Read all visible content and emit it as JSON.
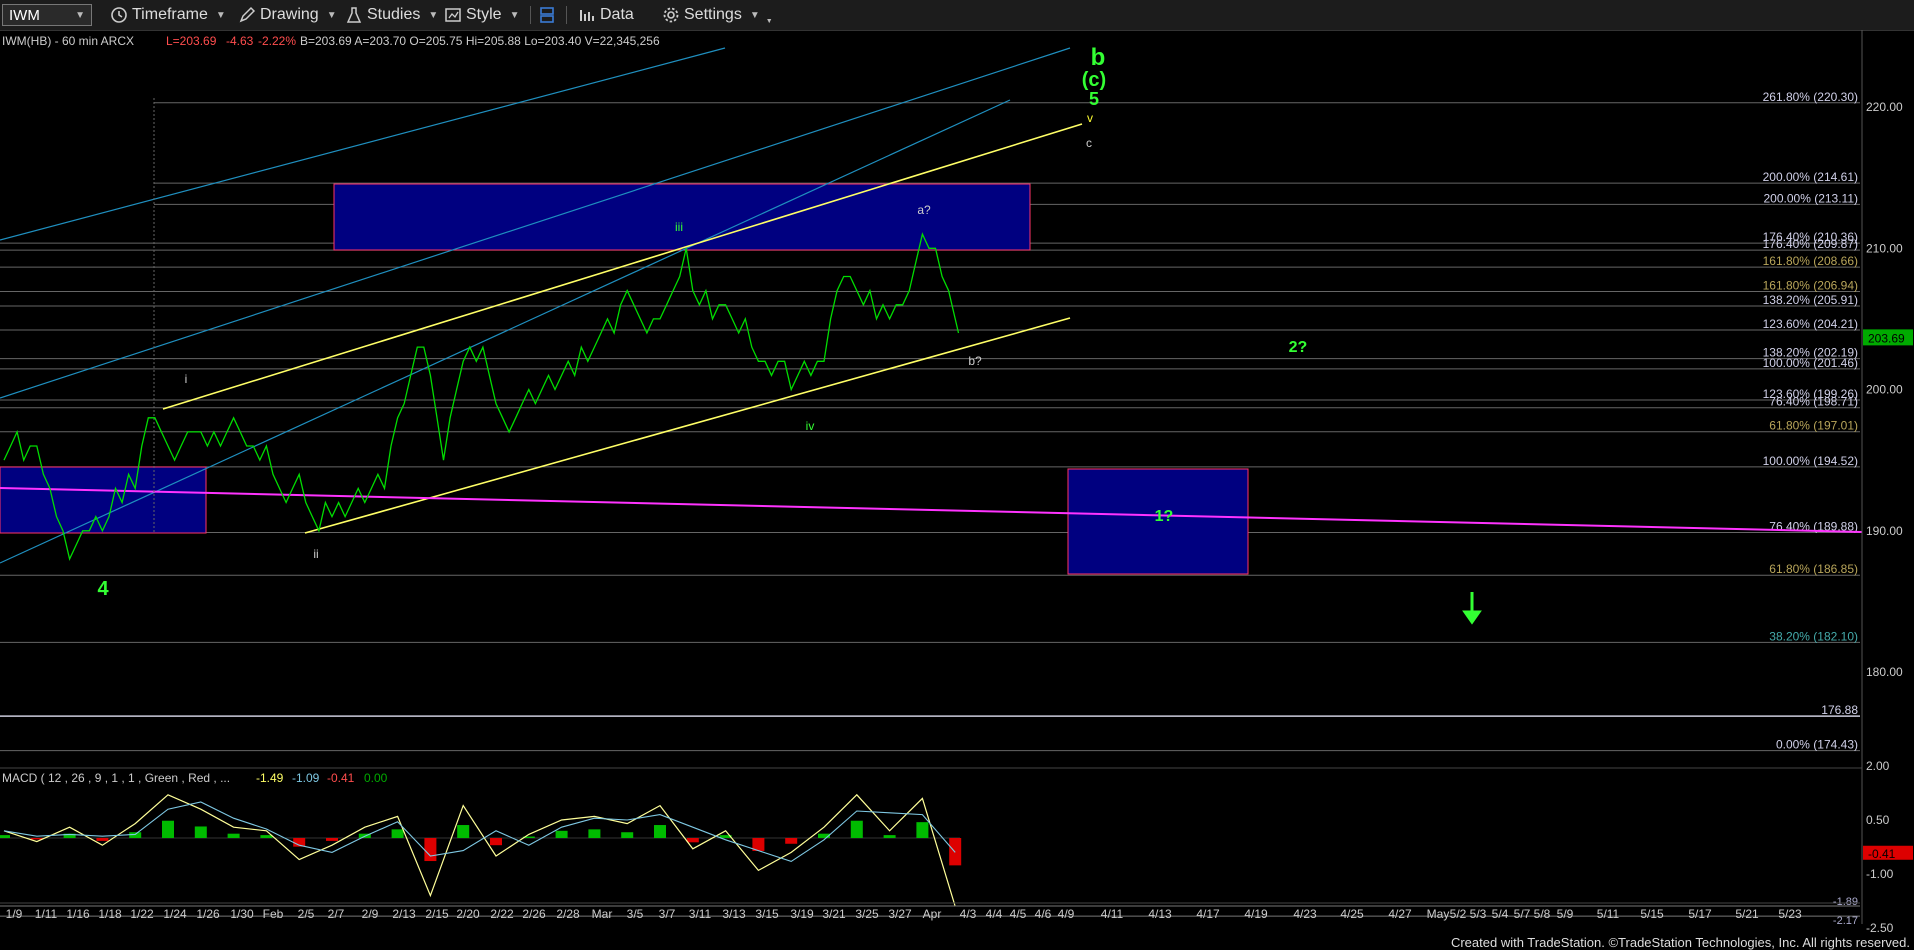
{
  "toolbar": {
    "symbol": "IWM",
    "timeframe": "Timeframe",
    "drawing": "Drawing",
    "studies": "Studies",
    "style": "Style",
    "data": "Data",
    "settings": "Settings"
  },
  "header": {
    "symbol_desc": "IWM(HB) - 60 min  ARCX",
    "last": "L=203.69",
    "chg": "-4.63",
    "pct": "-2.22%",
    "ohlc": "B=203.69  A=203.70  O=205.75  Hi=205.88  Lo=203.40  V=22,345,256"
  },
  "macd_header": {
    "label": "MACD ( 12 , 26 , 9 , 1 , 1 , Green , Red , ...",
    "v1": "-1.49",
    "v2": "-1.09",
    "v3": "-0.41",
    "v4": "0.00"
  },
  "footer": "Created with TradeStation. ©TradeStation Technologies, Inc. All rights reserved.",
  "colors": {
    "price": "#00dd00",
    "channel": "#ffff66",
    "magenta": "#ff33ff",
    "box": "#000080",
    "label_green": "#33ff33"
  },
  "chart_data": {
    "type": "line",
    "price_axis": {
      "ticks": [
        "220.00",
        "210.00",
        "200.00",
        "190.00",
        "180.00"
      ],
      "current": "203.69"
    },
    "macd_axis": {
      "ticks": [
        "2.00",
        "0.50",
        "-1.00",
        "-2.50"
      ],
      "badges": [
        "-0.41",
        "-1.89",
        "-2.17"
      ]
    },
    "x_labels": [
      "1/9",
      "1/11",
      "1/16",
      "1/18",
      "1/22",
      "1/24",
      "1/26",
      "1/30",
      "Feb",
      "2/5",
      "2/7",
      "2/9",
      "2/13",
      "2/15",
      "2/20",
      "2/22",
      "2/26",
      "2/28",
      "Mar",
      "3/5",
      "3/7",
      "3/11",
      "3/13",
      "3/15",
      "3/19",
      "3/21",
      "3/25",
      "3/27",
      "Apr",
      "4/3",
      "4/4",
      "4/5",
      "4/6",
      "4/9",
      "4/11",
      "4/13",
      "4/17",
      "4/19",
      "4/23",
      "4/25",
      "4/27",
      "May",
      "5/2",
      "5/3",
      "5/4",
      "5/7",
      "5/8",
      "5/9",
      "5/11",
      "5/15",
      "5/17",
      "5/21",
      "5/23"
    ],
    "fib_levels": [
      {
        "label": "261.80% (220.30)",
        "value": 220.3
      },
      {
        "label": "200.00% (214.61)",
        "value": 214.61
      },
      {
        "label": "200.00% (213.11)",
        "value": 213.11
      },
      {
        "label": "176.40% (210.36)",
        "value": 210.36
      },
      {
        "label": "176.40% (209.87)",
        "value": 209.87
      },
      {
        "label": "161.80% (208.66)",
        "value": 208.66
      },
      {
        "label": "161.80% (206.94)",
        "value": 206.94
      },
      {
        "label": "138.20% (205.91)",
        "value": 205.91
      },
      {
        "label": "123.60% (204.21)",
        "value": 204.21
      },
      {
        "label": "138.20% (202.19)",
        "value": 202.19
      },
      {
        "label": "100.00% (201.46)",
        "value": 201.46
      },
      {
        "label": "123.60% (199.26)",
        "value": 199.26
      },
      {
        "label": "76.40% (198.71)",
        "value": 198.71
      },
      {
        "label": "61.80% (197.01)",
        "value": 197.01
      },
      {
        "label": "100.00% (194.52)",
        "value": 194.52
      },
      {
        "label": "76.40% (189.88)",
        "value": 189.88
      },
      {
        "label": "61.80% (186.85)",
        "value": 186.85
      },
      {
        "label": "38.20% (182.10)",
        "value": 182.1
      },
      {
        "label": "176.88",
        "value": 176.88
      },
      {
        "label": "0.00% (174.43)",
        "value": 174.43
      }
    ],
    "wave_labels": {
      "b": "b",
      "c": "(c)",
      "five": "5",
      "v": "v",
      "cc": "c",
      "iii": "iii",
      "a": "a?",
      "i": "i",
      "bq": "b?",
      "iv": "iv",
      "ii": "ii",
      "four": "4",
      "one": "1?",
      "two": "2?"
    },
    "price_path": [
      [
        0,
        195
      ],
      [
        0.2,
        196
      ],
      [
        0.4,
        197
      ],
      [
        0.6,
        195
      ],
      [
        0.8,
        196
      ],
      [
        1.0,
        196
      ],
      [
        1.2,
        194
      ],
      [
        1.4,
        193
      ],
      [
        1.6,
        191
      ],
      [
        1.8,
        190
      ],
      [
        2.0,
        188
      ],
      [
        2.2,
        189
      ],
      [
        2.4,
        190
      ],
      [
        2.6,
        190
      ],
      [
        2.8,
        191
      ],
      [
        3.0,
        190
      ],
      [
        3.2,
        191
      ],
      [
        3.4,
        193
      ],
      [
        3.6,
        192
      ],
      [
        3.8,
        194
      ],
      [
        4.0,
        193
      ],
      [
        4.2,
        196
      ],
      [
        4.4,
        198
      ],
      [
        4.6,
        198
      ],
      [
        4.8,
        197
      ],
      [
        5.0,
        196
      ],
      [
        5.2,
        195
      ],
      [
        5.4,
        196
      ],
      [
        5.6,
        197
      ],
      [
        5.8,
        197
      ],
      [
        6.0,
        197
      ],
      [
        6.2,
        196
      ],
      [
        6.4,
        197
      ],
      [
        6.6,
        196
      ],
      [
        6.8,
        197
      ],
      [
        7.0,
        198
      ],
      [
        7.2,
        197
      ],
      [
        7.4,
        196
      ],
      [
        7.6,
        196
      ],
      [
        7.8,
        195
      ],
      [
        8.0,
        196
      ],
      [
        8.2,
        194
      ],
      [
        8.4,
        193
      ],
      [
        8.6,
        192
      ],
      [
        8.8,
        193
      ],
      [
        9.0,
        194
      ],
      [
        9.2,
        192
      ],
      [
        9.4,
        191
      ],
      [
        9.6,
        190
      ],
      [
        9.8,
        192
      ],
      [
        10.0,
        191
      ],
      [
        10.2,
        192
      ],
      [
        10.4,
        191
      ],
      [
        10.6,
        192
      ],
      [
        10.8,
        193
      ],
      [
        11.0,
        192
      ],
      [
        11.2,
        193
      ],
      [
        11.4,
        194
      ],
      [
        11.6,
        193
      ],
      [
        11.8,
        196
      ],
      [
        12.0,
        198
      ],
      [
        12.2,
        199
      ],
      [
        12.4,
        201
      ],
      [
        12.6,
        203
      ],
      [
        12.8,
        203
      ],
      [
        13.0,
        201
      ],
      [
        13.2,
        198
      ],
      [
        13.4,
        195
      ],
      [
        13.6,
        198
      ],
      [
        13.8,
        200
      ],
      [
        14.0,
        202
      ],
      [
        14.2,
        203
      ],
      [
        14.4,
        202
      ],
      [
        14.6,
        203
      ],
      [
        14.8,
        201
      ],
      [
        15.0,
        199
      ],
      [
        15.2,
        198
      ],
      [
        15.4,
        197
      ],
      [
        15.6,
        198
      ],
      [
        15.8,
        199
      ],
      [
        16.0,
        200
      ],
      [
        16.2,
        199
      ],
      [
        16.4,
        200
      ],
      [
        16.6,
        201
      ],
      [
        16.8,
        200
      ],
      [
        17.0,
        201
      ],
      [
        17.2,
        202
      ],
      [
        17.4,
        201
      ],
      [
        17.6,
        203
      ],
      [
        17.8,
        202
      ],
      [
        18.0,
        203
      ],
      [
        18.2,
        204
      ],
      [
        18.4,
        205
      ],
      [
        18.6,
        204
      ],
      [
        18.8,
        206
      ],
      [
        19.0,
        207
      ],
      [
        19.2,
        206
      ],
      [
        19.4,
        205
      ],
      [
        19.6,
        204
      ],
      [
        19.8,
        205
      ],
      [
        20.0,
        205
      ],
      [
        20.2,
        206
      ],
      [
        20.4,
        207
      ],
      [
        20.6,
        208
      ],
      [
        20.8,
        210
      ],
      [
        21.0,
        207
      ],
      [
        21.2,
        206
      ],
      [
        21.4,
        207
      ],
      [
        21.6,
        205
      ],
      [
        21.8,
        206
      ],
      [
        22.0,
        206
      ],
      [
        22.2,
        205
      ],
      [
        22.4,
        204
      ],
      [
        22.6,
        205
      ],
      [
        22.8,
        203
      ],
      [
        23.0,
        202
      ],
      [
        23.2,
        202
      ],
      [
        23.4,
        201
      ],
      [
        23.6,
        202
      ],
      [
        23.8,
        202
      ],
      [
        24.0,
        200
      ],
      [
        24.2,
        201
      ],
      [
        24.4,
        202
      ],
      [
        24.6,
        201
      ],
      [
        24.8,
        202
      ],
      [
        25.0,
        202
      ],
      [
        25.2,
        205
      ],
      [
        25.4,
        207
      ],
      [
        25.6,
        208
      ],
      [
        25.8,
        208
      ],
      [
        26.0,
        207
      ],
      [
        26.2,
        206
      ],
      [
        26.4,
        207
      ],
      [
        26.6,
        205
      ],
      [
        26.8,
        206
      ],
      [
        27.0,
        205
      ],
      [
        27.2,
        206
      ],
      [
        27.4,
        206
      ],
      [
        27.6,
        207
      ],
      [
        27.8,
        209
      ],
      [
        28.0,
        211
      ],
      [
        28.2,
        210
      ],
      [
        28.4,
        210
      ],
      [
        28.6,
        208
      ],
      [
        28.8,
        207
      ],
      [
        29.0,
        205
      ],
      [
        29.1,
        204
      ]
    ],
    "macd_path": [
      [
        0,
        0.2
      ],
      [
        1,
        -0.1
      ],
      [
        2,
        0.3
      ],
      [
        3,
        -0.2
      ],
      [
        4,
        0.4
      ],
      [
        5,
        1.2
      ],
      [
        6,
        0.8
      ],
      [
        7,
        0.3
      ],
      [
        8,
        0.2
      ],
      [
        9,
        -0.6
      ],
      [
        10,
        -0.2
      ],
      [
        11,
        0.3
      ],
      [
        12,
        0.6
      ],
      [
        13,
        -1.6
      ],
      [
        14,
        0.9
      ],
      [
        15,
        -0.5
      ],
      [
        16,
        0.1
      ],
      [
        17,
        0.5
      ],
      [
        18,
        0.6
      ],
      [
        19,
        0.4
      ],
      [
        20,
        0.9
      ],
      [
        21,
        -0.3
      ],
      [
        22,
        0.2
      ],
      [
        23,
        -0.9
      ],
      [
        24,
        -0.4
      ],
      [
        25,
        0.3
      ],
      [
        26,
        1.2
      ],
      [
        27,
        0.2
      ],
      [
        28,
        1.1
      ],
      [
        29,
        -1.9
      ]
    ]
  }
}
